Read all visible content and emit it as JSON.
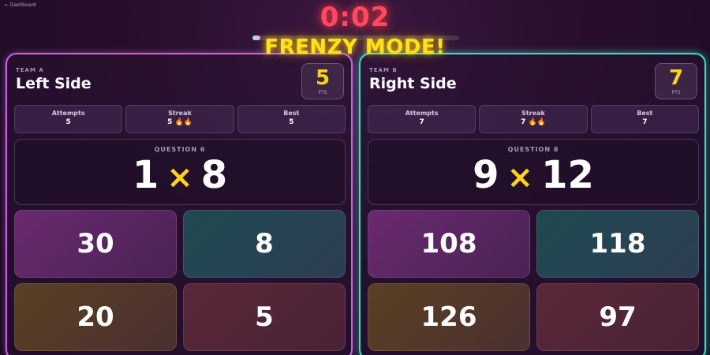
{
  "nav": {
    "back_label": "← Dashboard"
  },
  "timer": "0:02",
  "progress_fraction": 0.04,
  "banner": "FRENZY MODE!",
  "colors": {
    "timer": "#ff4a5e",
    "banner": "#ffe11a",
    "left_border": "#c864e6",
    "right_border": "#2ee6c4",
    "points": "#ffd21a"
  },
  "left": {
    "team_label": "TEAM A",
    "team_name": "Left Side",
    "points": "5",
    "points_label": "PTS",
    "stats": [
      {
        "label": "Attempts",
        "value": "5"
      },
      {
        "label": "Streak",
        "value": "5 🔥🔥"
      },
      {
        "label": "Best",
        "value": "5"
      }
    ],
    "question_label": "QUESTION 6",
    "operand_a": "1",
    "operator": "×",
    "operand_b": "8",
    "answers": [
      "30",
      "8",
      "20",
      "5"
    ]
  },
  "right": {
    "team_label": "TEAM B",
    "team_name": "Right Side",
    "points": "7",
    "points_label": "PTS",
    "stats": [
      {
        "label": "Attempts",
        "value": "7"
      },
      {
        "label": "Streak",
        "value": "7 🔥🔥"
      },
      {
        "label": "Best",
        "value": "7"
      }
    ],
    "question_label": "QUESTION 8",
    "operand_a": "9",
    "operator": "×",
    "operand_b": "12",
    "answers": [
      "108",
      "118",
      "126",
      "97"
    ]
  }
}
